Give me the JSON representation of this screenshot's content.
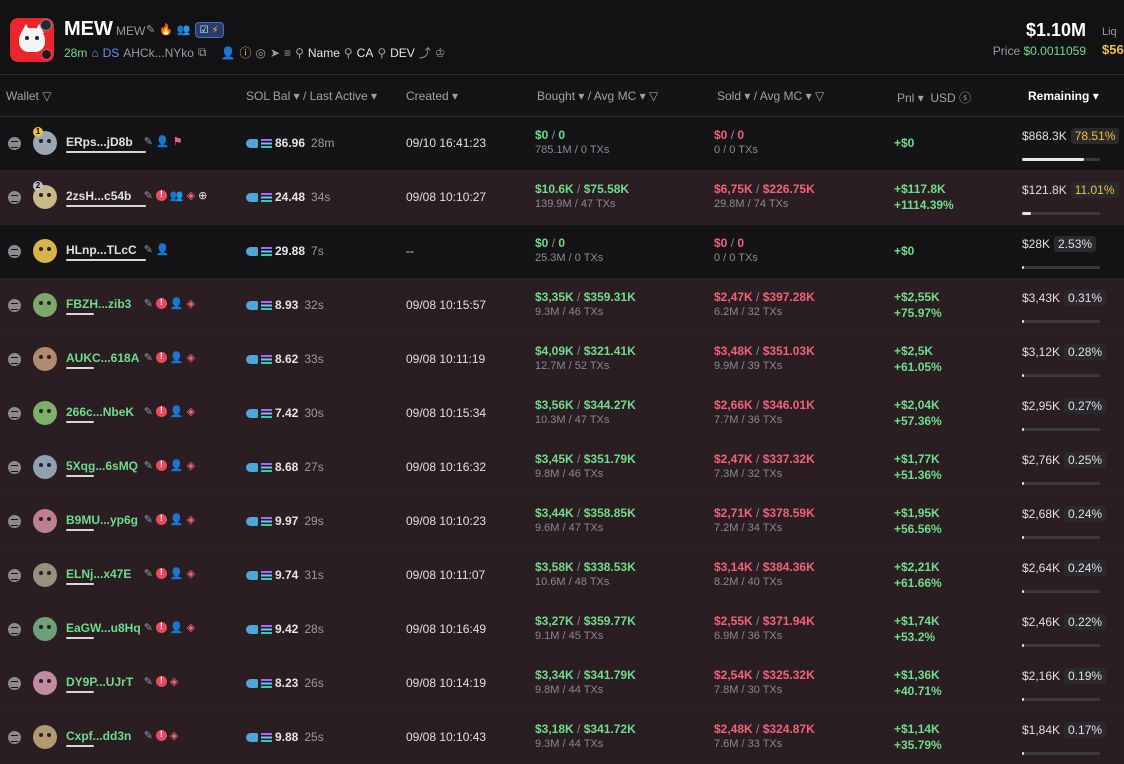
{
  "token": {
    "ticker": "MEW",
    "subname": "MEW",
    "age": "28m",
    "ds_label": "DS",
    "address": "AHCk...NYko",
    "search_links": [
      "Name",
      "CA",
      "DEV"
    ],
    "market_cap": "$1.10M",
    "price_label": "Price",
    "price_value": "$0.0011059",
    "liq_label": "Liq",
    "liq_value": "$56"
  },
  "columns": {
    "wallet": "Wallet",
    "sol_bal": "SOL Bal",
    "last_active": "/ Last Active",
    "created": "Created",
    "bought": "Bought",
    "avg_mc_b": "/ Avg MC",
    "sold": "Sold",
    "avg_mc_s": "/ Avg MC",
    "pnl": "Pnl",
    "usd": "USD",
    "remaining": "Remaining"
  },
  "rows": [
    {
      "rank": "1",
      "name": "ERps...jD8b",
      "sol": "86.96",
      "ago": "28m",
      "created": "09/10 16:41:23",
      "bought": "$0",
      "bought_avg": "0",
      "bought_sub": "785.1M / 0 TXs",
      "sold": "$0",
      "sold_avg": "0",
      "sold_sub": "0 / 0 TXs",
      "pnl1": "+$0",
      "pnl2": "",
      "remaining": "$868.3K",
      "pct": "78.51%",
      "fill": 0.785
    },
    {
      "rank": "2",
      "name": "2zsH...c54b",
      "sol": "24.48",
      "ago": "34s",
      "created": "09/08 10:10:27",
      "bought": "$10.6K",
      "bought_avg": "$75.58K",
      "bought_sub": "139.9M / 47 TXs",
      "sold": "$6,75K",
      "sold_avg": "$226.75K",
      "sold_sub": "29.8M / 74 TXs",
      "pnl1": "+$117.8K",
      "pnl2": "+1114.39%",
      "remaining": "$121.8K",
      "pct": "11.01%",
      "fill": 0.11
    },
    {
      "rank": "",
      "name": "HLnp...TLcC",
      "sol": "29.88",
      "ago": "7s",
      "created": "--",
      "bought": "$0",
      "bought_avg": "0",
      "bought_sub": "25.3M / 0 TXs",
      "sold": "$0",
      "sold_avg": "0",
      "sold_sub": "0 / 0 TXs",
      "pnl1": "+$0",
      "pnl2": "",
      "remaining": "$28K",
      "pct": "2.53%",
      "fill": 0.025
    },
    {
      "rank": "",
      "name": "FBZH...zib3",
      "sol": "8.93",
      "ago": "32s",
      "created": "09/08 10:15:57",
      "bought": "$3,35K",
      "bought_avg": "$359.31K",
      "bought_sub": "9.3M / 46 TXs",
      "sold": "$2,47K",
      "sold_avg": "$397.28K",
      "sold_sub": "6.2M / 32 TXs",
      "pnl1": "+$2,55K",
      "pnl2": "+75.97%",
      "remaining": "$3,43K",
      "pct": "0.31%",
      "fill": 0.003
    },
    {
      "rank": "",
      "name": "AUKC...618A",
      "sol": "8.62",
      "ago": "33s",
      "created": "09/08 10:11:19",
      "bought": "$4,09K",
      "bought_avg": "$321.41K",
      "bought_sub": "12.7M / 52 TXs",
      "sold": "$3,48K",
      "sold_avg": "$351.03K",
      "sold_sub": "9.9M / 39 TXs",
      "pnl1": "+$2,5K",
      "pnl2": "+61.05%",
      "remaining": "$3,12K",
      "pct": "0.28%",
      "fill": 0.003
    },
    {
      "rank": "",
      "name": "266c...NbeK",
      "sol": "7.42",
      "ago": "30s",
      "created": "09/08 10:15:34",
      "bought": "$3,56K",
      "bought_avg": "$344.27K",
      "bought_sub": "10.3M / 47 TXs",
      "sold": "$2,66K",
      "sold_avg": "$346.01K",
      "sold_sub": "7.7M / 36 TXs",
      "pnl1": "+$2,04K",
      "pnl2": "+57.36%",
      "remaining": "$2,95K",
      "pct": "0.27%",
      "fill": 0.003
    },
    {
      "rank": "",
      "name": "5Xqg...6sMQ",
      "sol": "8.68",
      "ago": "27s",
      "created": "09/08 10:16:32",
      "bought": "$3,45K",
      "bought_avg": "$351.79K",
      "bought_sub": "9.8M / 46 TXs",
      "sold": "$2,47K",
      "sold_avg": "$337.32K",
      "sold_sub": "7.3M / 32 TXs",
      "pnl1": "+$1,77K",
      "pnl2": "+51.36%",
      "remaining": "$2,76K",
      "pct": "0.25%",
      "fill": 0.002
    },
    {
      "rank": "",
      "name": "B9MU...yp6g",
      "sol": "9.97",
      "ago": "29s",
      "created": "09/08 10:10:23",
      "bought": "$3,44K",
      "bought_avg": "$358.85K",
      "bought_sub": "9.6M / 47 TXs",
      "sold": "$2,71K",
      "sold_avg": "$378.59K",
      "sold_sub": "7.2M / 34 TXs",
      "pnl1": "+$1,95K",
      "pnl2": "+56.56%",
      "remaining": "$2,68K",
      "pct": "0.24%",
      "fill": 0.002
    },
    {
      "rank": "",
      "name": "ELNj...x47E",
      "sol": "9.74",
      "ago": "31s",
      "created": "09/08 10:11:07",
      "bought": "$3,58K",
      "bought_avg": "$338.53K",
      "bought_sub": "10.6M / 48 TXs",
      "sold": "$3,14K",
      "sold_avg": "$384.36K",
      "sold_sub": "8.2M / 40 TXs",
      "pnl1": "+$2,21K",
      "pnl2": "+61.66%",
      "remaining": "$2,64K",
      "pct": "0.24%",
      "fill": 0.002
    },
    {
      "rank": "",
      "name": "EaGW...u8Hq",
      "sol": "9.42",
      "ago": "28s",
      "created": "09/08 10:16:49",
      "bought": "$3,27K",
      "bought_avg": "$359.77K",
      "bought_sub": "9.1M / 45 TXs",
      "sold": "$2,55K",
      "sold_avg": "$371.94K",
      "sold_sub": "6.9M / 36 TXs",
      "pnl1": "+$1,74K",
      "pnl2": "+53.2%",
      "remaining": "$2,46K",
      "pct": "0.22%",
      "fill": 0.002
    },
    {
      "rank": "",
      "name": "DY9P...UJrT",
      "sol": "8.23",
      "ago": "26s",
      "created": "09/08 10:14:19",
      "bought": "$3,34K",
      "bought_avg": "$341.79K",
      "bought_sub": "9.8M / 44 TXs",
      "sold": "$2,54K",
      "sold_avg": "$325.32K",
      "sold_sub": "7.8M / 30 TXs",
      "pnl1": "+$1,36K",
      "pnl2": "+40.71%",
      "remaining": "$2,16K",
      "pct": "0.19%",
      "fill": 0.002
    },
    {
      "rank": "",
      "name": "Cxpf...dd3n",
      "sol": "9.88",
      "ago": "25s",
      "created": "09/08 10:10:43",
      "bought": "$3,18K",
      "bought_avg": "$341.72K",
      "bought_sub": "9.3M / 44 TXs",
      "sold": "$2,48K",
      "sold_avg": "$324.87K",
      "sold_sub": "7.6M / 33 TXs",
      "pnl1": "+$1,14K",
      "pnl2": "+35.79%",
      "remaining": "$1,84K",
      "pct": "0.17%",
      "fill": 0.002
    }
  ]
}
